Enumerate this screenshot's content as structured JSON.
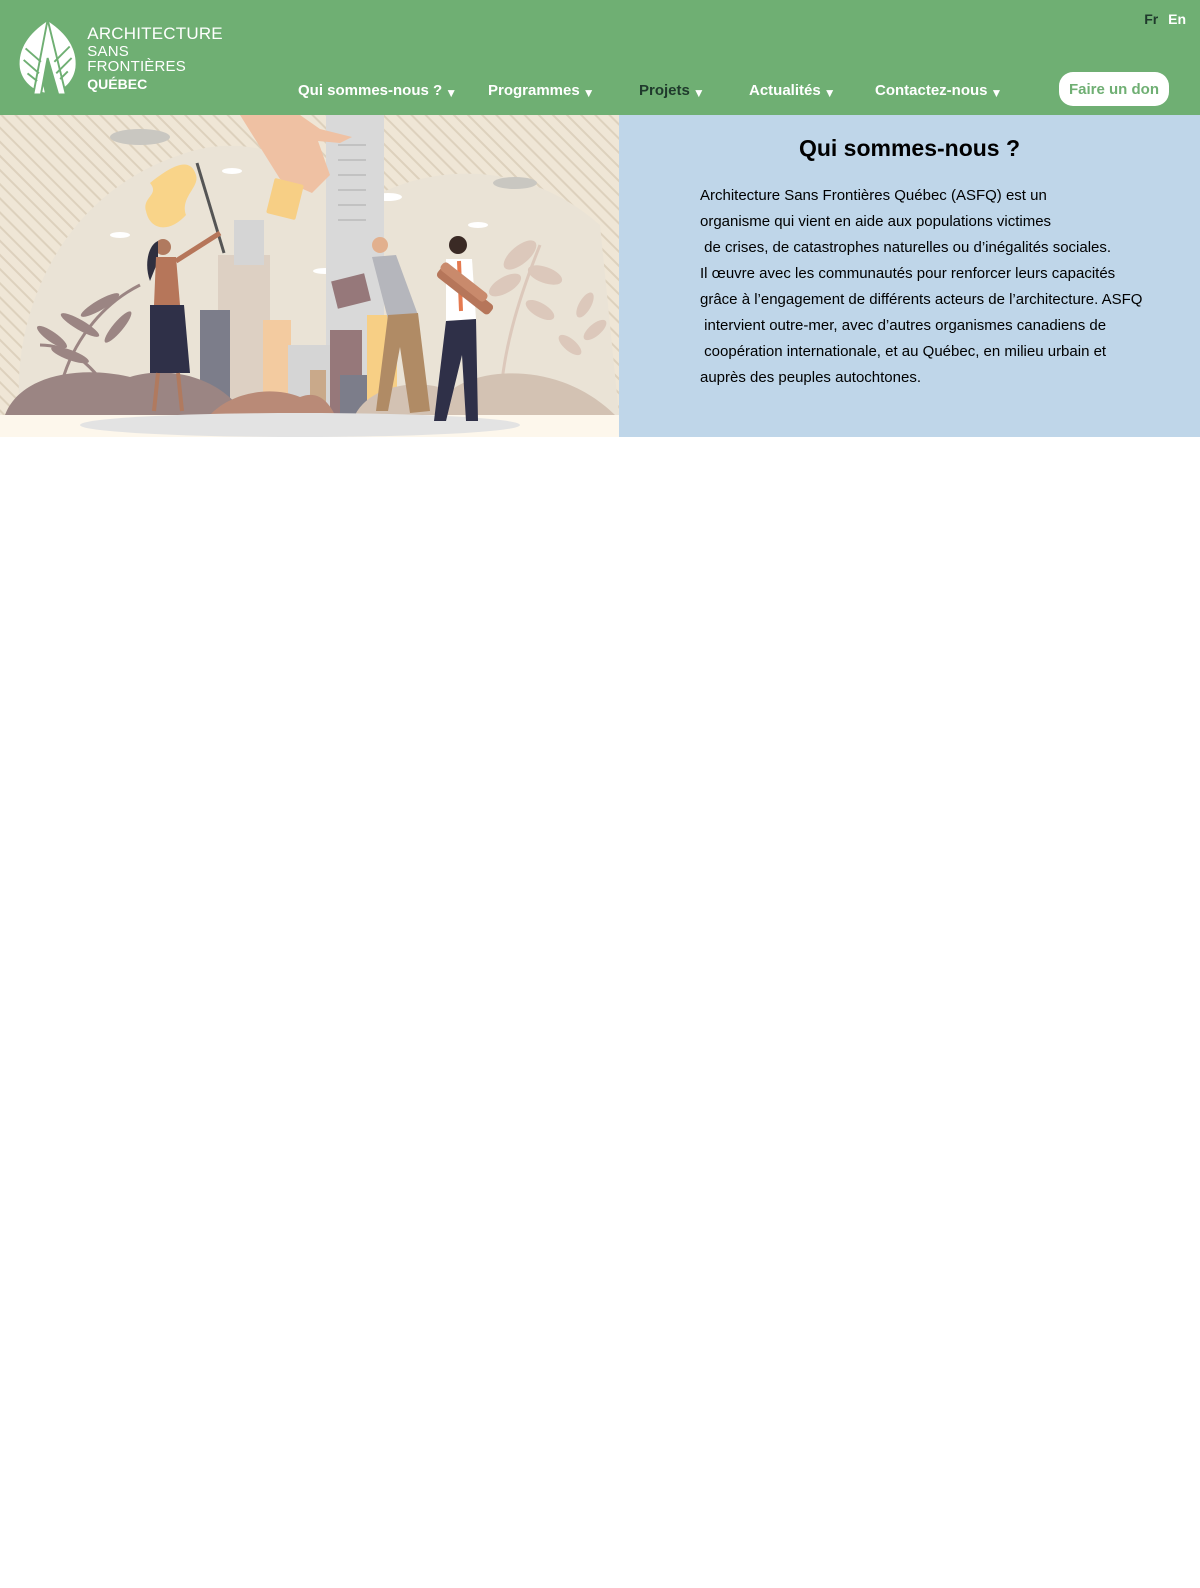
{
  "header": {
    "logo": {
      "line1": "ARCHITECTURE",
      "line2": "SANS FRONTIÈRES",
      "line3": "QUÉBEC"
    },
    "lang": {
      "fr": "Fr",
      "en": "En",
      "active": "Fr"
    },
    "nav": [
      {
        "label": "Qui sommes-nous ?",
        "caret": "▼"
      },
      {
        "label": "Programmes",
        "caret": "▼"
      },
      {
        "label": "Projets",
        "caret": "▼",
        "active": true
      },
      {
        "label": "Actualités",
        "caret": "▼"
      },
      {
        "label": "Contactez-nous",
        "caret": "▼"
      }
    ],
    "donate_label": "Faire un don"
  },
  "about": {
    "title": "Qui sommes-nous ?",
    "lines": [
      "Architecture Sans Frontières Québec (ASFQ) est un",
      "organisme qui vient en aide aux populations victimes",
      " de crises, de catastrophes naturelles ou d’inégalités sociales.",
      "Il œuvre avec les communautés pour renforcer leurs capacités",
      "grâce à l’engagement de différents acteurs de l’architecture. ASFQ",
      " intervient outre-mer, avec d’autres organismes canadiens de",
      " coopération internationale, et au Québec, en milieu urbain et",
      "auprès des peuples autochtones."
    ]
  },
  "colors": {
    "header_green": "#6faf73",
    "about_blue": "#bfd6e9",
    "active_nav": "#1f3a2c"
  }
}
